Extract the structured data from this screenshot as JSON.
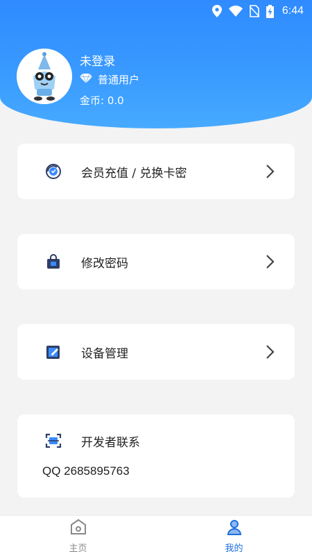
{
  "status_bar": {
    "time": "6:44"
  },
  "profile": {
    "username": "未登录",
    "level": "普通用户",
    "coins": "金币: 0.0"
  },
  "menu": {
    "recharge": "会员充值 / 兑换卡密",
    "change_password": "修改密码",
    "device_management": "设备管理"
  },
  "developer": {
    "title": "开发者联系",
    "contact": "QQ 2685895763"
  },
  "tabs": {
    "home": "主页",
    "mine": "我的"
  },
  "colors": {
    "accent": "#2f8bff",
    "active_tab": "#1f6fe0",
    "inactive_tab": "#888888"
  }
}
